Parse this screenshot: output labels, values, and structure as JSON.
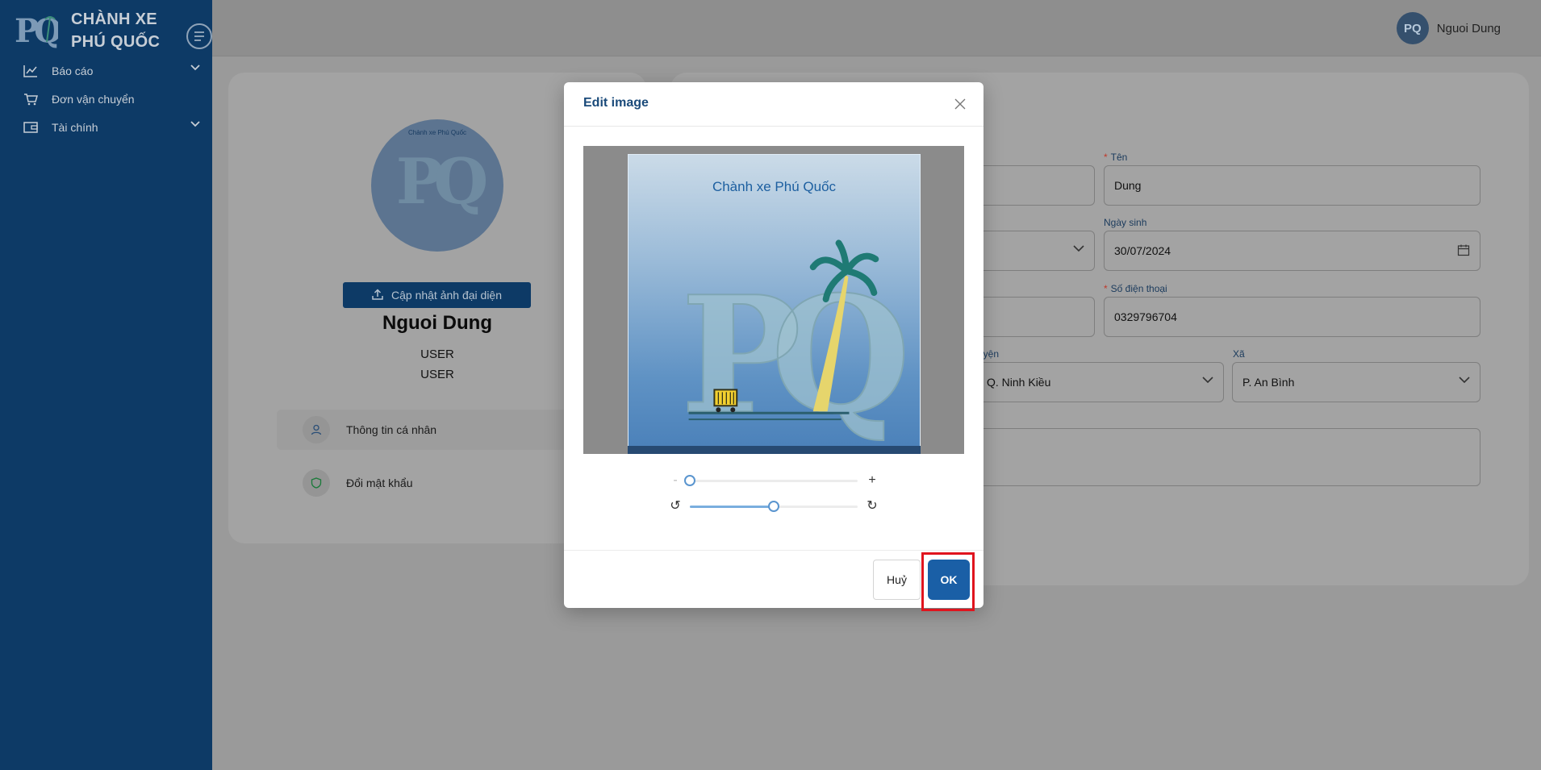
{
  "sidebar": {
    "brand": {
      "line1": "CHÀNH XE",
      "line2": "PHÚ QUỐC",
      "logo_text": "PQ"
    },
    "items": [
      {
        "label": "Báo cáo",
        "icon": "line-chart-icon",
        "has_children": true
      },
      {
        "label": "Đơn vận chuyển",
        "icon": "cart-icon",
        "has_children": false
      },
      {
        "label": "Tài chính",
        "icon": "wallet-icon",
        "has_children": true
      }
    ]
  },
  "header": {
    "user_name": "Nguoi Dung",
    "avatar_text": "PQ"
  },
  "profile": {
    "avatar_caption": "Chành xe Phú Quốc",
    "avatar_letters": "PQ",
    "upload_label": "Cập nhật ảnh đại diện",
    "name": "Nguoi Dung",
    "roles": [
      "USER",
      "USER"
    ],
    "links": [
      {
        "label": "Thông tin cá nhân",
        "icon": "user-icon",
        "active": true
      },
      {
        "label": "Đổi mật khẩu",
        "icon": "shield-icon",
        "active": false
      }
    ]
  },
  "form": {
    "ten_label": "Tên",
    "ten_value": "Dung",
    "ngay_sinh_label": "Ngày sinh",
    "ngay_sinh_value": "30/07/2024",
    "sdt_label": "Số điện thoại",
    "sdt_value": "0329796704",
    "huyen_label": "uyện",
    "huyen_value": "Q. Ninh Kiều",
    "xa_label": "Xã",
    "xa_value": "P. An Bình"
  },
  "modal": {
    "title": "Edit image",
    "image_caption": "Chành xe Phú Quốc",
    "image_letters": "PQ",
    "zoom_minus": "-",
    "zoom_plus": "+",
    "zoom_level": 0,
    "rotate_left": "↺",
    "rotate_right": "↻",
    "rotation_level": 0.5,
    "cancel_label": "Huỷ",
    "ok_label": "OK"
  }
}
